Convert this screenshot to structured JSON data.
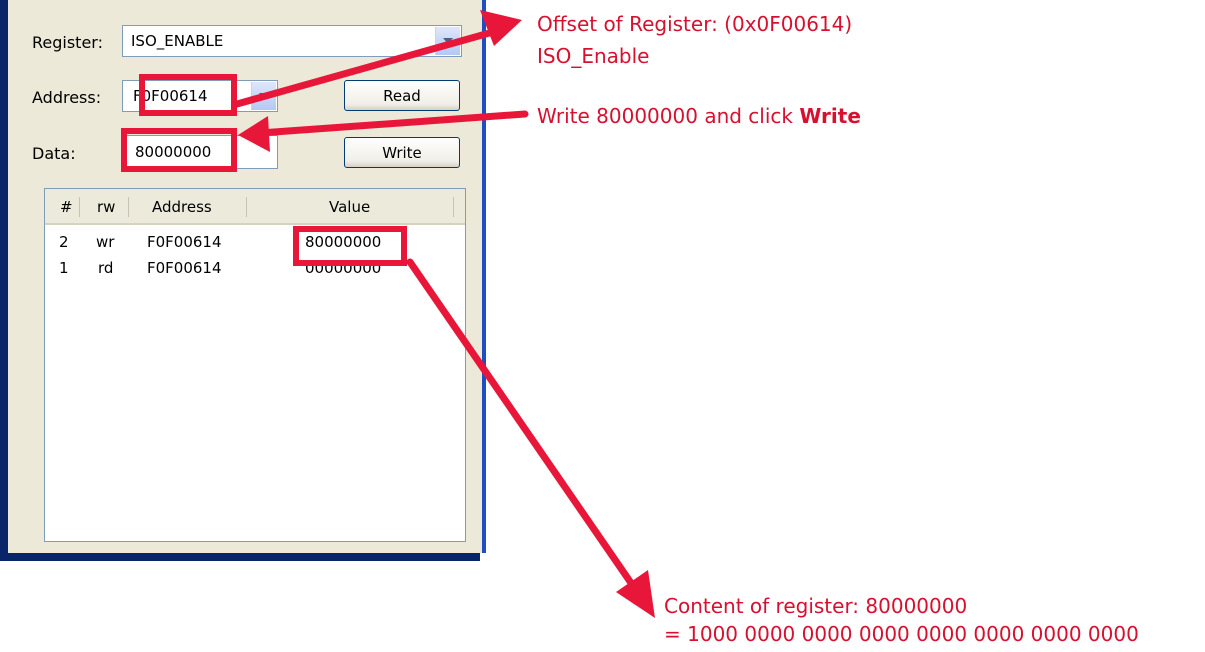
{
  "form": {
    "register_label": "Register:",
    "register_value": "ISO_ENABLE",
    "address_label": "Address:",
    "address_value": "F0F00614",
    "data_label": "Data:",
    "data_value": "80000000",
    "read_button": "Read",
    "write_button": "Write"
  },
  "table": {
    "headers": [
      "#",
      "rw",
      "Address",
      "Value"
    ],
    "rows": [
      {
        "num": "2",
        "rw": "wr",
        "address": "F0F00614",
        "value": "80000000"
      },
      {
        "num": "1",
        "rw": "rd",
        "address": "F0F00614",
        "value": "00000000"
      }
    ]
  },
  "annotations": {
    "offset_line1": "Offset of Register: (0x0F00614)",
    "offset_line2": "ISO_Enable",
    "write_text": "Write 80000000 and click ",
    "write_bold": "Write",
    "content_line1": "Content of register: 80000000",
    "content_line2": "= 1000 0000 0000 0000 0000 0000 0000 0000"
  },
  "colors": {
    "annotation_red": "#e8173a",
    "window_border_blue": "#1f4ec0",
    "panel_bg": "#ece9d8"
  }
}
